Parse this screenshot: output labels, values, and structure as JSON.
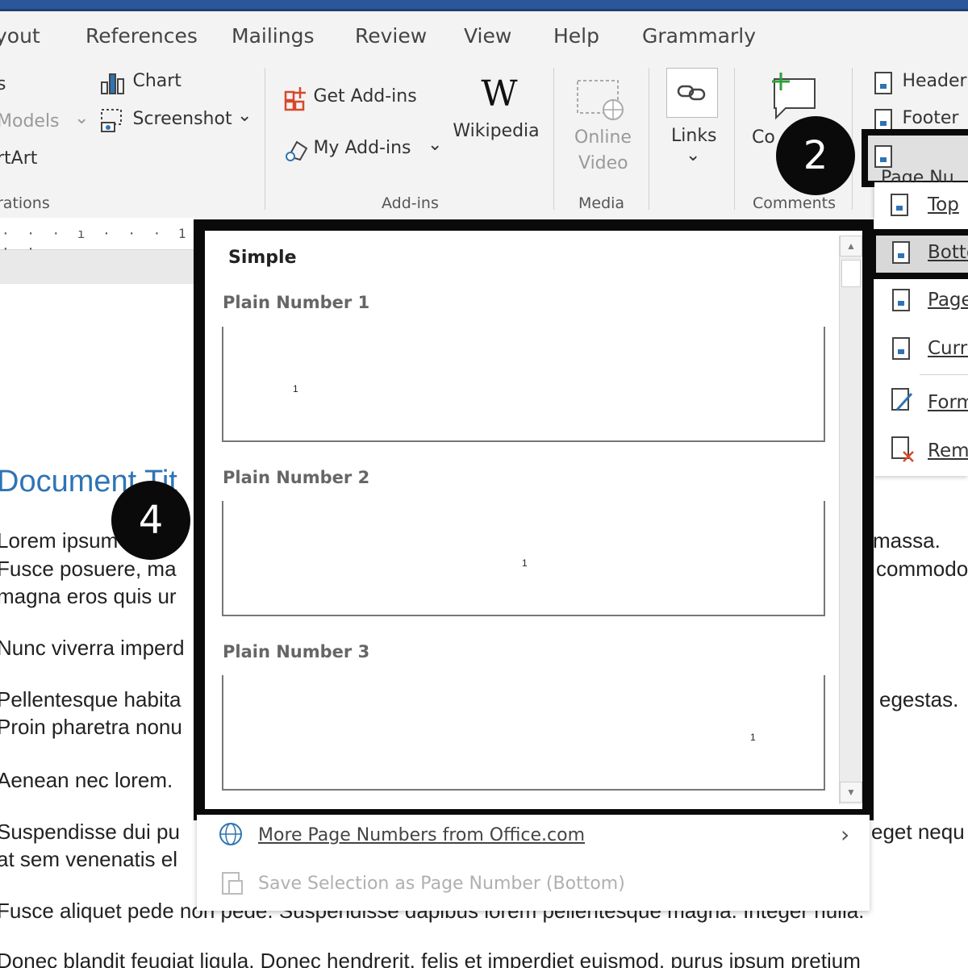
{
  "tabs": [
    "yout",
    "References",
    "Mailings",
    "Review",
    "View",
    "Help",
    "Grammarly"
  ],
  "ribbon": {
    "left_items": [
      "s",
      "Models",
      "rtArt"
    ],
    "left_group_label": "rations",
    "chart_label": "Chart",
    "screenshot_label": "Screenshot",
    "get_addins": "Get Add-ins",
    "my_addins": "My Add-ins",
    "wikipedia": "Wikipedia",
    "addins_group": "Add-ins",
    "online_video_line1": "Online",
    "online_video_line2": "Video",
    "media_group": "Media",
    "links": "Links",
    "comment_partial": "Co",
    "comments_group": "Comments",
    "header": "Header",
    "footer": "Footer",
    "page_number": "Page Nu",
    "wikipedia_glyph": "W",
    "chevron": "⌄"
  },
  "ruler": {
    "text": "· · · ı · · · 1 · ·"
  },
  "document": {
    "title": "Document Tit",
    "lines": [
      {
        "left": "Lorem ipsum",
        "right": "massa."
      },
      {
        "left": "Fusce posuere, ma",
        "right": "commodo"
      },
      {
        "left": "magna eros quis ur",
        "right": ""
      },
      {
        "left": "Nunc viverra imperd",
        "right": ""
      },
      {
        "left": "Pellentesque habita",
        "right": "egestas."
      },
      {
        "left": "Proin pharetra nonu",
        "right": ""
      },
      {
        "left": "Aenean nec lorem.",
        "right": ""
      },
      {
        "left": "Suspendisse dui pu",
        "right": "eget nequ"
      },
      {
        "left": "at sem venenatis el",
        "right": ""
      }
    ],
    "bottom_line_1": "Fusce aliquet pede non pede. Suspendisse dapibus lorem pellentesque magna. Integer nulla.",
    "bottom_line_2": "Donec blandit feugiat ligula. Donec hendrerit, felis et imperdiet euismod, purus ipsum pretium"
  },
  "callouts": {
    "step2": "2",
    "step4": "4"
  },
  "gallery": {
    "section": "Simple",
    "options": [
      {
        "label": "Plain Number 1",
        "number": "1"
      },
      {
        "label": "Plain Number 2",
        "number": "1"
      },
      {
        "label": "Plain Number 3",
        "number": "1"
      }
    ],
    "more": "More Page Numbers from Office.com",
    "save": "Save Selection as Page Number (Bottom)",
    "scroll_up": "▲",
    "scroll_down": "▼",
    "more_arrow": "›"
  },
  "menu": {
    "items": [
      "Top",
      "Botto",
      "Page",
      "Curre",
      "Form",
      "Rem"
    ]
  },
  "colors": {
    "accent": "#2b579a",
    "title_blue": "#2e74b5"
  }
}
